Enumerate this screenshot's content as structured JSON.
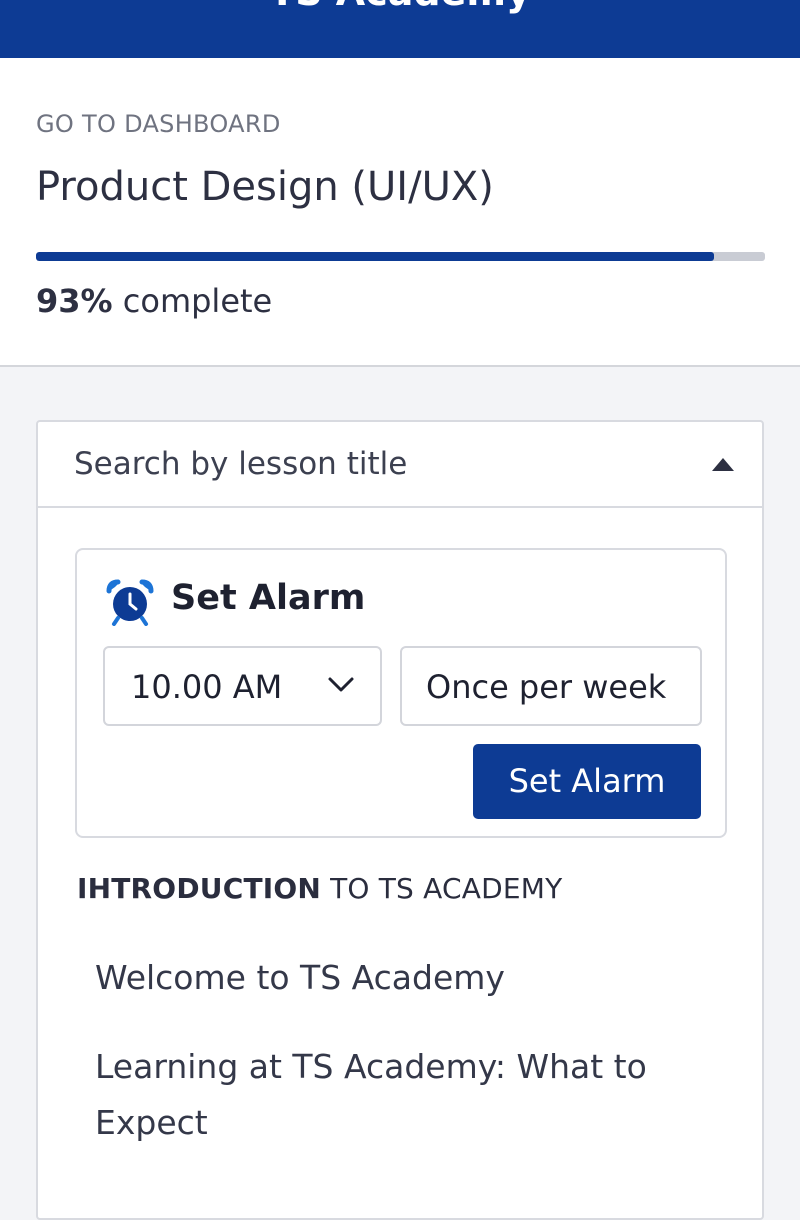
{
  "app": {
    "title": "TS Academy",
    "brand_color": "#0d3b94"
  },
  "header": {
    "breadcrumb": "GO TO DASHBOARD",
    "course_title": "Product Design (UI/UX)",
    "progress": {
      "fraction": 0.93,
      "percent_label": "93%",
      "suffix": "complete"
    }
  },
  "search": {
    "placeholder": "Search by lesson title",
    "toggle_icon": "caret-up-icon"
  },
  "alarm": {
    "title": "Set Alarm",
    "icon": "alarm-clock-icon",
    "time_value": "10.00 AM",
    "frequency_value": "Once per week",
    "button_label": "Set Alarm"
  },
  "section": {
    "heading_bold": "IHTRODUCTION",
    "heading_rest": " TO TS ACADEMY",
    "lessons": [
      "Welcome to TS Academy",
      "Learning at TS Academy: What to Expect"
    ]
  }
}
